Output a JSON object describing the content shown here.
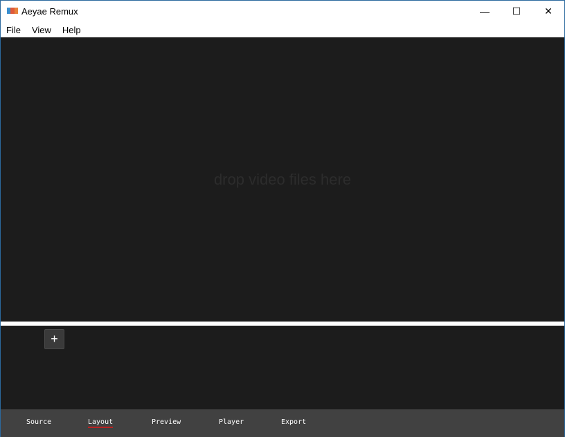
{
  "window": {
    "title": "Aeyae Remux",
    "icon": "app-icon",
    "controls": [
      "minimize-icon",
      "maximize-icon",
      "close-icon"
    ],
    "minimize": "—",
    "maximize": "☐",
    "close": "✕"
  },
  "menu": [
    "File",
    "View",
    "Help"
  ],
  "drop_area": {
    "hint": "drop video files here"
  },
  "timeline": {
    "add_label": "+"
  },
  "tabs": [
    {
      "label": "Source"
    },
    {
      "label": "Layout",
      "active": true
    },
    {
      "label": "Preview"
    },
    {
      "label": "Player"
    },
    {
      "label": "Export"
    }
  ],
  "colors": {
    "background": "#1c1c1c",
    "tabbar": "#414141",
    "active_underline": "#bb2222"
  }
}
